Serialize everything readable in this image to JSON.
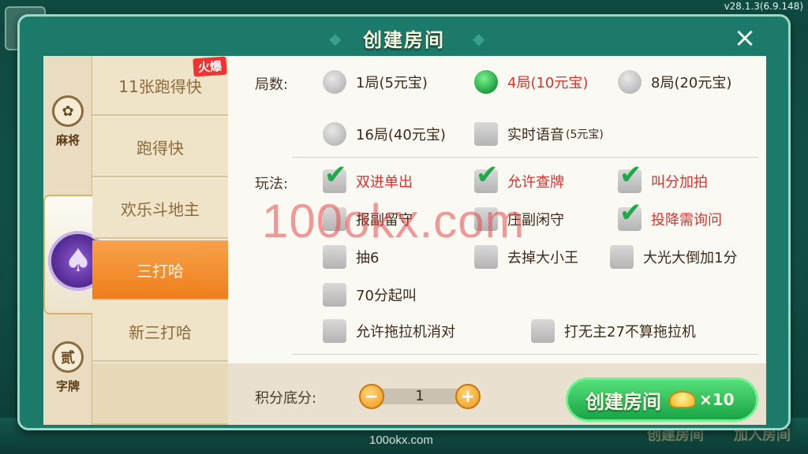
{
  "app": {
    "version": "v28.1.3(6.9.148)",
    "footer_url": "100okx.com"
  },
  "background": {
    "bottom_buttons": [
      "创建房间",
      "加入房间"
    ]
  },
  "dialog": {
    "title": "创建房间",
    "close_label": "×"
  },
  "categories": [
    {
      "label": "麻将",
      "icon": "mahjong-icon"
    },
    {
      "label": "字牌",
      "icon": "zipai-icon",
      "glyph": "贰"
    }
  ],
  "active_category_icon": "spade-icon",
  "games": [
    {
      "label": "11张跑得快",
      "badge": "火爆",
      "active": false
    },
    {
      "label": "跑得快",
      "active": false
    },
    {
      "label": "欢乐斗地主",
      "active": false
    },
    {
      "label": "三打哈",
      "active": true
    },
    {
      "label": "新三打哈",
      "active": false
    }
  ],
  "rounds": {
    "label": "局数:",
    "options": [
      {
        "label": "1局(5元宝)",
        "selected": false
      },
      {
        "label": "4局(10元宝)",
        "selected": true
      },
      {
        "label": "8局(20元宝)",
        "selected": false
      },
      {
        "label": "16局(40元宝)",
        "selected": false
      }
    ],
    "voice": {
      "label": "实时语音",
      "sub": "(5元宝)",
      "checked": false
    }
  },
  "rules": {
    "label": "玩法:",
    "options": [
      {
        "label": "双进单出",
        "checked": true
      },
      {
        "label": "允许查牌",
        "checked": true
      },
      {
        "label": "叫分加拍",
        "checked": true
      },
      {
        "label": "报副留守",
        "checked": false
      },
      {
        "label": "庄副闲守",
        "checked": false
      },
      {
        "label": "投降需询问",
        "checked": true
      },
      {
        "label": "抽6",
        "checked": false
      },
      {
        "label": "去掉大小王",
        "checked": false
      },
      {
        "label": "大光大倒加1分",
        "checked": false
      },
      {
        "label": "70分起叫",
        "checked": false
      },
      {
        "label": "允许拖拉机消对",
        "checked": false
      },
      {
        "label": "打无主27不算拖拉机",
        "checked": false
      }
    ]
  },
  "watermark": "100okx.com",
  "score": {
    "label": "积分底分:",
    "value": "1",
    "minus": "−",
    "plus": "+"
  },
  "create": {
    "label": "创建房间",
    "cost": "×10",
    "icon": "ingot-icon"
  },
  "colors": {
    "accent_green": "#19a446",
    "selected_red": "#e0302a",
    "active_tab": "#ee7f1c"
  }
}
